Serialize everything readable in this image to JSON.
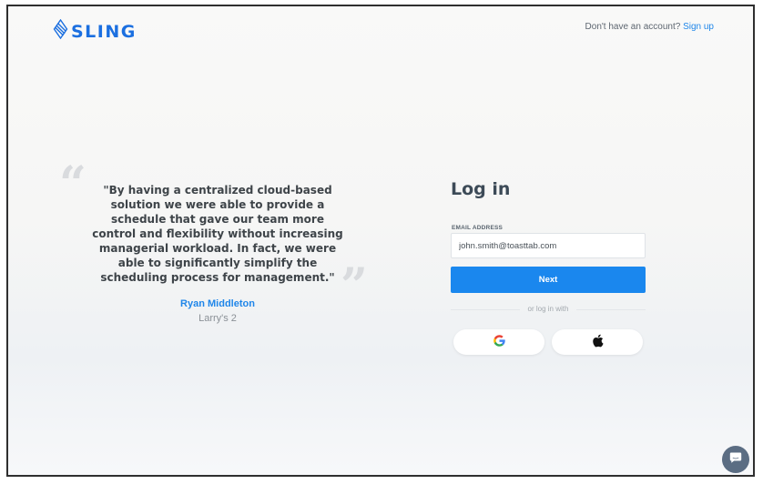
{
  "header": {
    "brand": "SLING",
    "signup_prompt": "Don't have an account?",
    "signup_link": "Sign up"
  },
  "testimonial": {
    "quote": "\"By having a centralized cloud-based solution we were able to provide a schedule that gave our team more control and flexibility without increasing managerial workload. In fact, we were able to significantly simplify the scheduling process for management.\"",
    "author": "Ryan Middleton",
    "company": "Larry's 2"
  },
  "login": {
    "title": "Log in",
    "email_label": "EMAIL ADDRESS",
    "email_value": "john.smith@toasttab.com",
    "next_label": "Next",
    "divider_text": "or log in with"
  },
  "colors": {
    "brand": "#1b6fe0",
    "link": "#1f86e9",
    "primary_button": "#1a87ee",
    "chat_bubble": "#5b6d83"
  },
  "icons": {
    "logo": "sling-logo-icon",
    "google": "google-icon",
    "apple": "apple-icon",
    "chat": "chat-icon"
  }
}
